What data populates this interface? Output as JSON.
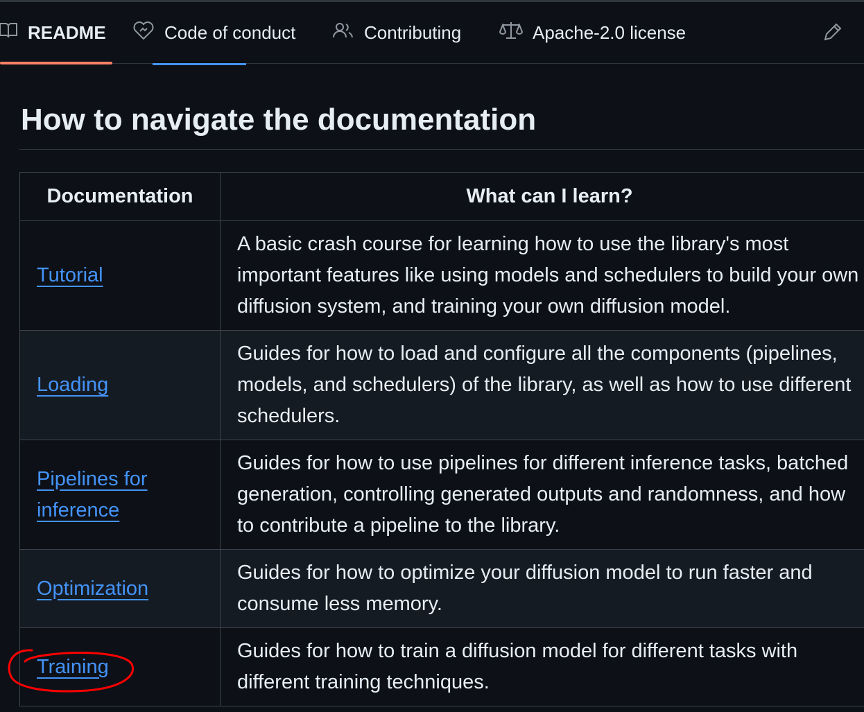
{
  "tabs": [
    {
      "label": "README",
      "icon": "book-icon"
    },
    {
      "label": "Code of conduct",
      "icon": "heart-handshake-icon"
    },
    {
      "label": "Contributing",
      "icon": "people-icon"
    },
    {
      "label": "Apache-2.0 license",
      "icon": "scale-icon"
    }
  ],
  "edit_icon": "pencil-icon",
  "accent_colors": {
    "active_tab": "#f78166",
    "link": "#4493f8",
    "annotation": "#ff0000"
  },
  "heading": "How to navigate the documentation",
  "table": {
    "headers": [
      "Documentation",
      "What can I learn?"
    ],
    "rows": [
      {
        "doc": "Tutorial",
        "desc": "A basic crash course for learning how to use the library's most important features like using models and schedulers to build your own diffusion system, and training your own diffusion model."
      },
      {
        "doc": "Loading",
        "desc": "Guides for how to load and configure all the components (pipelines, models, and schedulers) of the library, as well as how to use different schedulers."
      },
      {
        "doc": "Pipelines for inference",
        "desc": "Guides for how to use pipelines for different inference tasks, batched generation, controlling generated outputs and randomness, and how to contribute a pipeline to the library."
      },
      {
        "doc": "Optimization",
        "desc": "Guides for how to optimize your diffusion model to run faster and consume less memory."
      },
      {
        "doc": "Training",
        "desc": "Guides for how to train a diffusion model for different tasks with different training techniques."
      }
    ]
  }
}
